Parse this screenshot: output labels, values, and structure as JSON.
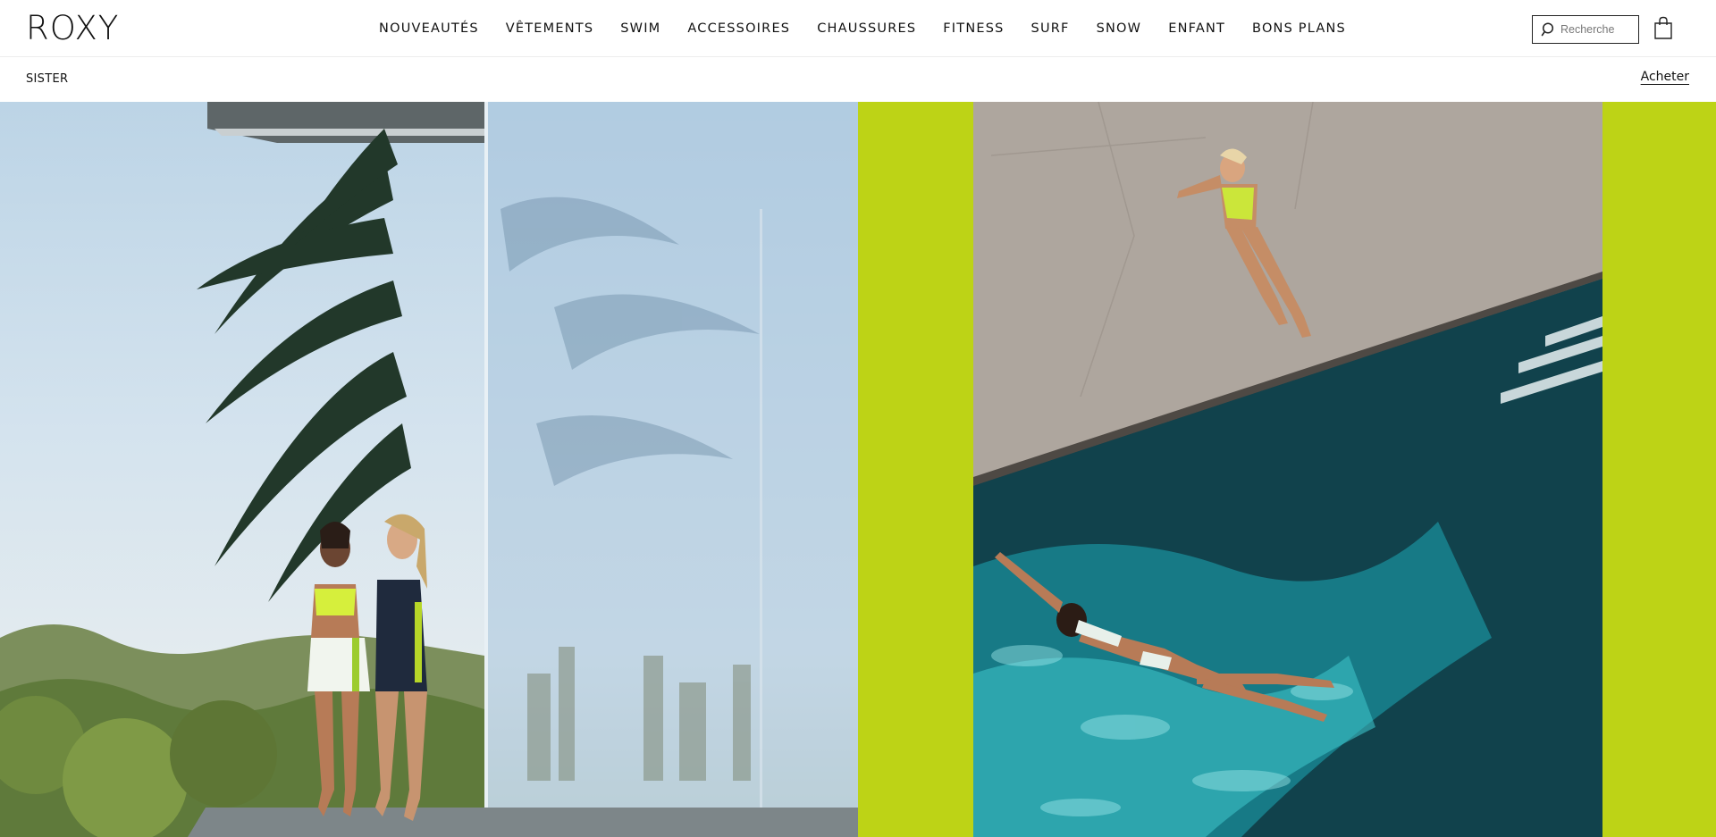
{
  "header": {
    "logo": "ROXY",
    "nav": [
      {
        "label": "NOUVEAUTÉS"
      },
      {
        "label": "VÊTEMENTS"
      },
      {
        "label": "SWIM"
      },
      {
        "label": "ACCESSOIRES"
      },
      {
        "label": "CHAUSSURES"
      },
      {
        "label": "FITNESS"
      },
      {
        "label": "SURF"
      },
      {
        "label": "SNOW"
      },
      {
        "label": "ENFANT"
      },
      {
        "label": "BONS PLANS"
      }
    ],
    "search": {
      "placeholder": "Recherche",
      "icon": "search-icon"
    },
    "cart_icon": "shopping-bag-icon"
  },
  "subbar": {
    "title": "SISTER",
    "cta": "Acheter"
  },
  "hero": {
    "accent_color": "#bdd316",
    "left_image": "two women in swimsuits on a terrace with palm trees and glass wall",
    "right_image": "aerial view of a woman lying on pool deck and a woman swimming in a pool"
  }
}
